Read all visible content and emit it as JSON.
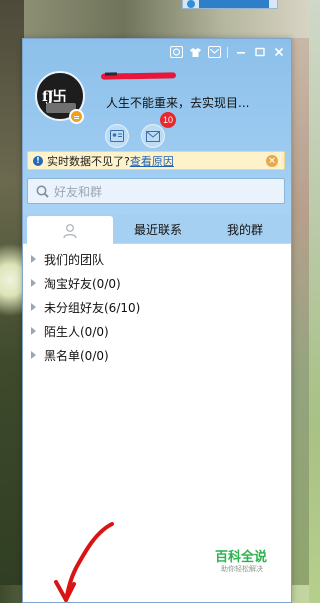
{
  "window": {
    "title_controls": [
      {
        "name": "qq-space-icon"
      },
      {
        "name": "skin-shirt-icon"
      },
      {
        "name": "message-box-icon"
      },
      {
        "name": "minimize-icon"
      },
      {
        "name": "maximize-icon"
      },
      {
        "name": "close-icon"
      }
    ]
  },
  "profile": {
    "nickname_redacted": true,
    "signature": "人生不能重来，去实现目...",
    "status": "away",
    "mail_badge_count": "10"
  },
  "notice": {
    "message": "实时数据不见了?",
    "link": "查看原因"
  },
  "search": {
    "placeholder": "好友和群"
  },
  "tabs": [
    {
      "label": "",
      "icon": "contacts-icon",
      "active": true
    },
    {
      "label": "最近联系",
      "active": false
    },
    {
      "label": "我的群",
      "active": false
    }
  ],
  "groups": [
    {
      "label": "我们的团队"
    },
    {
      "label": "淘宝好友(0/0)"
    },
    {
      "label": "未分组好友(6/10)"
    },
    {
      "label": "陌生人(0/0)"
    },
    {
      "label": "黑名单(0/0)"
    }
  ],
  "watermark": {
    "title": "百科全说",
    "subtitle": "助你轻松解决"
  },
  "colors": {
    "header_blue": "#8cc0ea",
    "notice_bg": "#fdf2c9",
    "link_blue": "#1e60b8",
    "badge_red": "#e8282c",
    "scribble_red": "#d91414"
  }
}
